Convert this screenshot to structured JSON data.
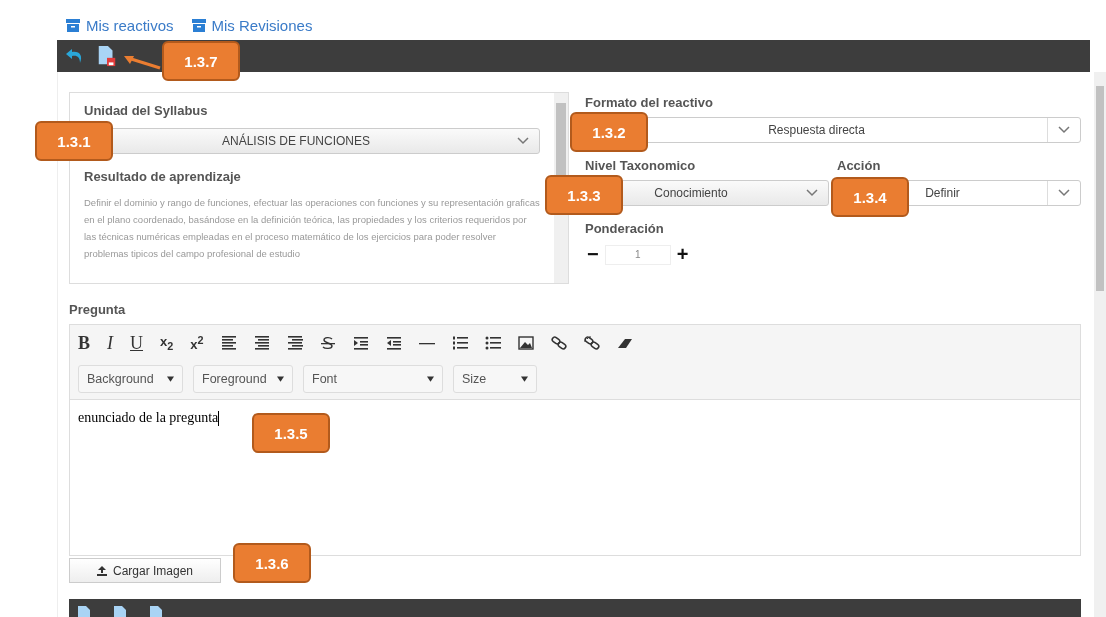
{
  "nav_links": [
    "Mis reactivos",
    "Mis Revisiones"
  ],
  "syllabus": {
    "label": "Unidad del Syllabus",
    "value": "ANÁLISIS DE FUNCIONES",
    "result_label": "Resultado de aprendizaje",
    "result_text": "Definir el dominio y rango de funciones, efectuar las operaciones con funciones y su representación graficas en el plano coordenado, basándose en la definición teórica, las propiedades y los criterios requeridos por las técnicas numéricas empleadas en el proceso matemático de los ejercicios para poder resolver problemas tipicos del campo profesional de estudio"
  },
  "format": {
    "label": "Formato del reactivo",
    "value": "Respuesta directa"
  },
  "taxonomy": {
    "label": "Nivel Taxonomico",
    "value": "Conocimiento"
  },
  "action": {
    "label": "Acción",
    "value": "Definir"
  },
  "weighting": {
    "label": "Ponderación",
    "minus": "−",
    "value": "1",
    "plus": "+"
  },
  "question": {
    "label": "Pregunta",
    "format_buttons": [
      "B",
      "I",
      "U",
      "x$_{2}$",
      "x$^{2}$"
    ],
    "dropdowns": [
      "Background",
      "Foreground",
      "Font",
      "Size"
    ],
    "content": "enunciado de la pregunta"
  },
  "upload_button": "Cargar Imagen",
  "callouts": [
    "1.3.7",
    "1.3.1",
    "1.3.2",
    "1.3.3",
    "1.3.4",
    "1.3.5",
    "1.3.6"
  ]
}
